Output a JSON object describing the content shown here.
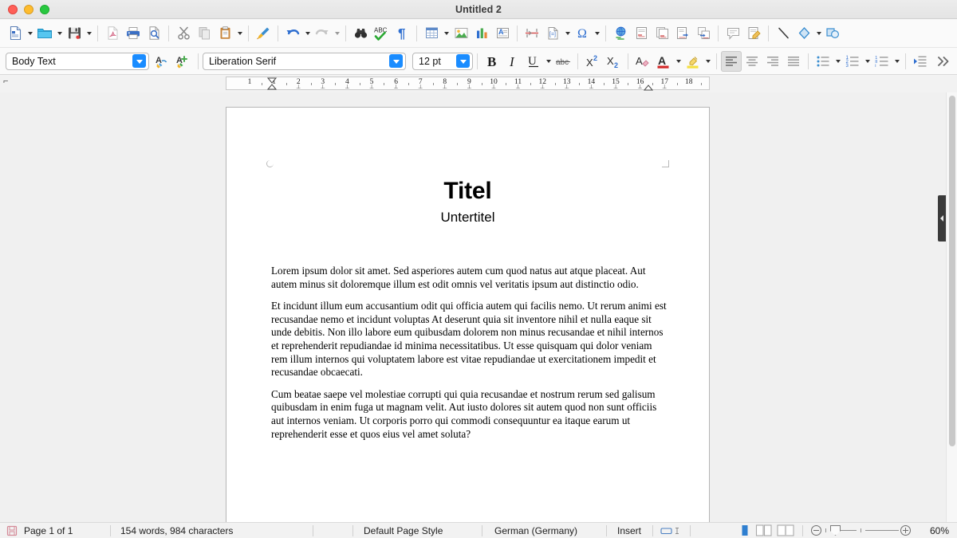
{
  "window": {
    "title": "Untitled 2",
    "traffic_lights": [
      "close-button",
      "minimize-button",
      "maximize-button"
    ]
  },
  "standard_toolbar": {
    "items": [
      {
        "name": "new-document",
        "icon": "new-doc-icon",
        "dropdown": true
      },
      {
        "name": "open-document",
        "icon": "open-folder-icon",
        "dropdown": true
      },
      {
        "name": "save-document",
        "icon": "save-floppy-icon",
        "dropdown": true
      },
      {
        "name": "export-pdf",
        "icon": "export-pdf-icon",
        "dropdown": false
      },
      {
        "name": "print",
        "icon": "printer-icon",
        "dropdown": false
      },
      {
        "name": "print-preview",
        "icon": "print-preview-icon",
        "dropdown": false
      },
      {
        "name": "cut",
        "icon": "scissors-icon",
        "dropdown": false
      },
      {
        "name": "copy",
        "icon": "copy-icon",
        "dropdown": false
      },
      {
        "name": "paste",
        "icon": "clipboard-icon",
        "dropdown": true
      },
      {
        "name": "clone-formatting",
        "icon": "paintbrush-icon",
        "dropdown": false
      },
      {
        "name": "undo",
        "icon": "undo-arrow-icon",
        "dropdown": true
      },
      {
        "name": "redo",
        "icon": "redo-arrow-icon",
        "dropdown": true
      },
      {
        "name": "find-and-replace",
        "icon": "binoculars-icon",
        "dropdown": false
      },
      {
        "name": "spelling",
        "icon": "abc-checkmark-icon",
        "dropdown": false
      },
      {
        "name": "formatting-marks",
        "icon": "pilcrow-icon",
        "dropdown": false
      },
      {
        "name": "insert-table",
        "icon": "table-icon",
        "dropdown": true
      },
      {
        "name": "insert-image",
        "icon": "image-icon",
        "dropdown": false
      },
      {
        "name": "insert-chart",
        "icon": "chart-bars-icon",
        "dropdown": false
      },
      {
        "name": "insert-text-box",
        "icon": "text-box-icon",
        "dropdown": false
      },
      {
        "name": "insert-page-break",
        "icon": "page-break-icon",
        "dropdown": false
      },
      {
        "name": "insert-field",
        "icon": "field-icon",
        "dropdown": true
      },
      {
        "name": "insert-special-character",
        "icon": "omega-icon",
        "dropdown": true
      },
      {
        "name": "insert-hyperlink",
        "icon": "globe-link-icon",
        "dropdown": false
      },
      {
        "name": "insert-footnote",
        "icon": "footnote-icon",
        "dropdown": false
      },
      {
        "name": "insert-endnote",
        "icon": "endnote-icon",
        "dropdown": false
      },
      {
        "name": "insert-bookmark",
        "icon": "bookmark-icon",
        "dropdown": false
      },
      {
        "name": "insert-cross-reference",
        "icon": "cross-reference-icon",
        "dropdown": false
      },
      {
        "name": "insert-comment",
        "icon": "comment-bubble-icon",
        "dropdown": false
      },
      {
        "name": "track-changes",
        "icon": "track-changes-icon",
        "dropdown": false
      },
      {
        "name": "insert-line",
        "icon": "line-icon",
        "dropdown": false
      },
      {
        "name": "basic-shapes",
        "icon": "diamond-shape-icon",
        "dropdown": true
      },
      {
        "name": "show-draw-functions",
        "icon": "draw-functions-icon",
        "dropdown": false
      }
    ]
  },
  "formatting_toolbar": {
    "paragraph_style": {
      "value": "Body Text",
      "placeholder": "Paragraph Style"
    },
    "font_name": {
      "value": "Liberation Serif",
      "placeholder": "Font Name"
    },
    "font_size": {
      "value": "12 pt",
      "placeholder": "Font Size"
    },
    "buttons": [
      {
        "name": "update-selected-style",
        "icon": "update-style-icon"
      },
      {
        "name": "new-style-from-selection",
        "icon": "new-style-icon"
      },
      {
        "name": "bold",
        "label": "B",
        "icon": "bold-icon"
      },
      {
        "name": "italic",
        "label": "I",
        "icon": "italic-icon"
      },
      {
        "name": "underline",
        "label": "U",
        "icon": "underline-icon",
        "dropdown": true
      },
      {
        "name": "strikethrough",
        "label": "abc",
        "icon": "strikethrough-icon"
      },
      {
        "name": "superscript",
        "label": "X²",
        "icon": "superscript-icon"
      },
      {
        "name": "subscript",
        "label": "X₂",
        "icon": "subscript-icon"
      },
      {
        "name": "clear-formatting",
        "icon": "clear-formatting-icon"
      },
      {
        "name": "font-color",
        "icon": "font-color-icon",
        "dropdown": true
      },
      {
        "name": "highlight-color",
        "icon": "highlight-color-icon",
        "dropdown": true
      },
      {
        "name": "align-left",
        "icon": "align-left-icon",
        "selected": true
      },
      {
        "name": "align-center",
        "icon": "align-center-icon"
      },
      {
        "name": "align-right",
        "icon": "align-right-icon"
      },
      {
        "name": "align-justified",
        "icon": "align-justify-icon"
      },
      {
        "name": "unordered-list",
        "icon": "bullet-list-icon",
        "dropdown": true
      },
      {
        "name": "ordered-list",
        "icon": "numbered-list-icon",
        "dropdown": true
      },
      {
        "name": "outline-list",
        "icon": "outline-list-icon",
        "dropdown": true
      },
      {
        "name": "increase-indent",
        "icon": "increase-indent-icon"
      },
      {
        "name": "overflow-more",
        "icon": "chevron-double-right-icon"
      }
    ]
  },
  "ruler": {
    "corner_label": "⌐",
    "numbers": [
      "1",
      "1",
      "2",
      "3",
      "4",
      "5",
      "6",
      "7",
      "8",
      "9",
      "10",
      "11",
      "12",
      "13",
      "14",
      "15",
      "16",
      "17",
      "18"
    ]
  },
  "document": {
    "title": "Titel",
    "subtitle": "Untertitel",
    "paragraphs": [
      "Lorem ipsum dolor sit amet. Sed asperiores autem cum quod natus aut atque placeat. Aut autem minus sit doloremque illum est odit omnis vel veritatis ipsum aut distinctio odio.",
      "Et incidunt illum eum accusantium odit qui officia autem qui facilis nemo. Ut rerum animi est recusandae nemo et incidunt voluptas At deserunt quia sit inventore nihil et nulla eaque sit unde debitis. Non illo labore eum quibusdam dolorem non minus recusandae et nihil internos et reprehenderit repudiandae id minima necessitatibus. Ut esse quisquam qui dolor veniam rem illum internos qui voluptatem labore est vitae repudiandae ut exercitationem impedit et recusandae obcaecati.",
      "Cum beatae saepe vel molestiae corrupti qui quia recusandae et nostrum rerum sed galisum quibusdam in enim fuga ut magnam velit. Aut iusto dolores sit autem quod non sunt officiis aut internos veniam. Ut corporis porro qui commodi consequuntur ea itaque earum ut reprehenderit esse et quos eius vel amet soluta?"
    ]
  },
  "statusbar": {
    "save_icon": "save-status-icon",
    "page_info": "Page 1 of 1",
    "word_count": "154 words, 984 characters",
    "page_style": "Default Page Style",
    "language": "German (Germany)",
    "insert_mode": "Insert",
    "selection_mode_icon": "selection-mode-icon",
    "view_single_page": "single-page-view-icon",
    "view_multi_page": "multi-page-view-icon",
    "view_book": "book-view-icon",
    "zoom_out_icon": "zoom-out-icon",
    "zoom_in_icon": "zoom-in-icon",
    "zoom_level": "60%"
  },
  "colors": {
    "accent_blue": "#1a8cff",
    "toolbar_bg": "#fafafa",
    "page_bg": "#ffffff",
    "workspace_bg": "#f0f0f0",
    "statusbar_bg": "#f2f2f2"
  }
}
